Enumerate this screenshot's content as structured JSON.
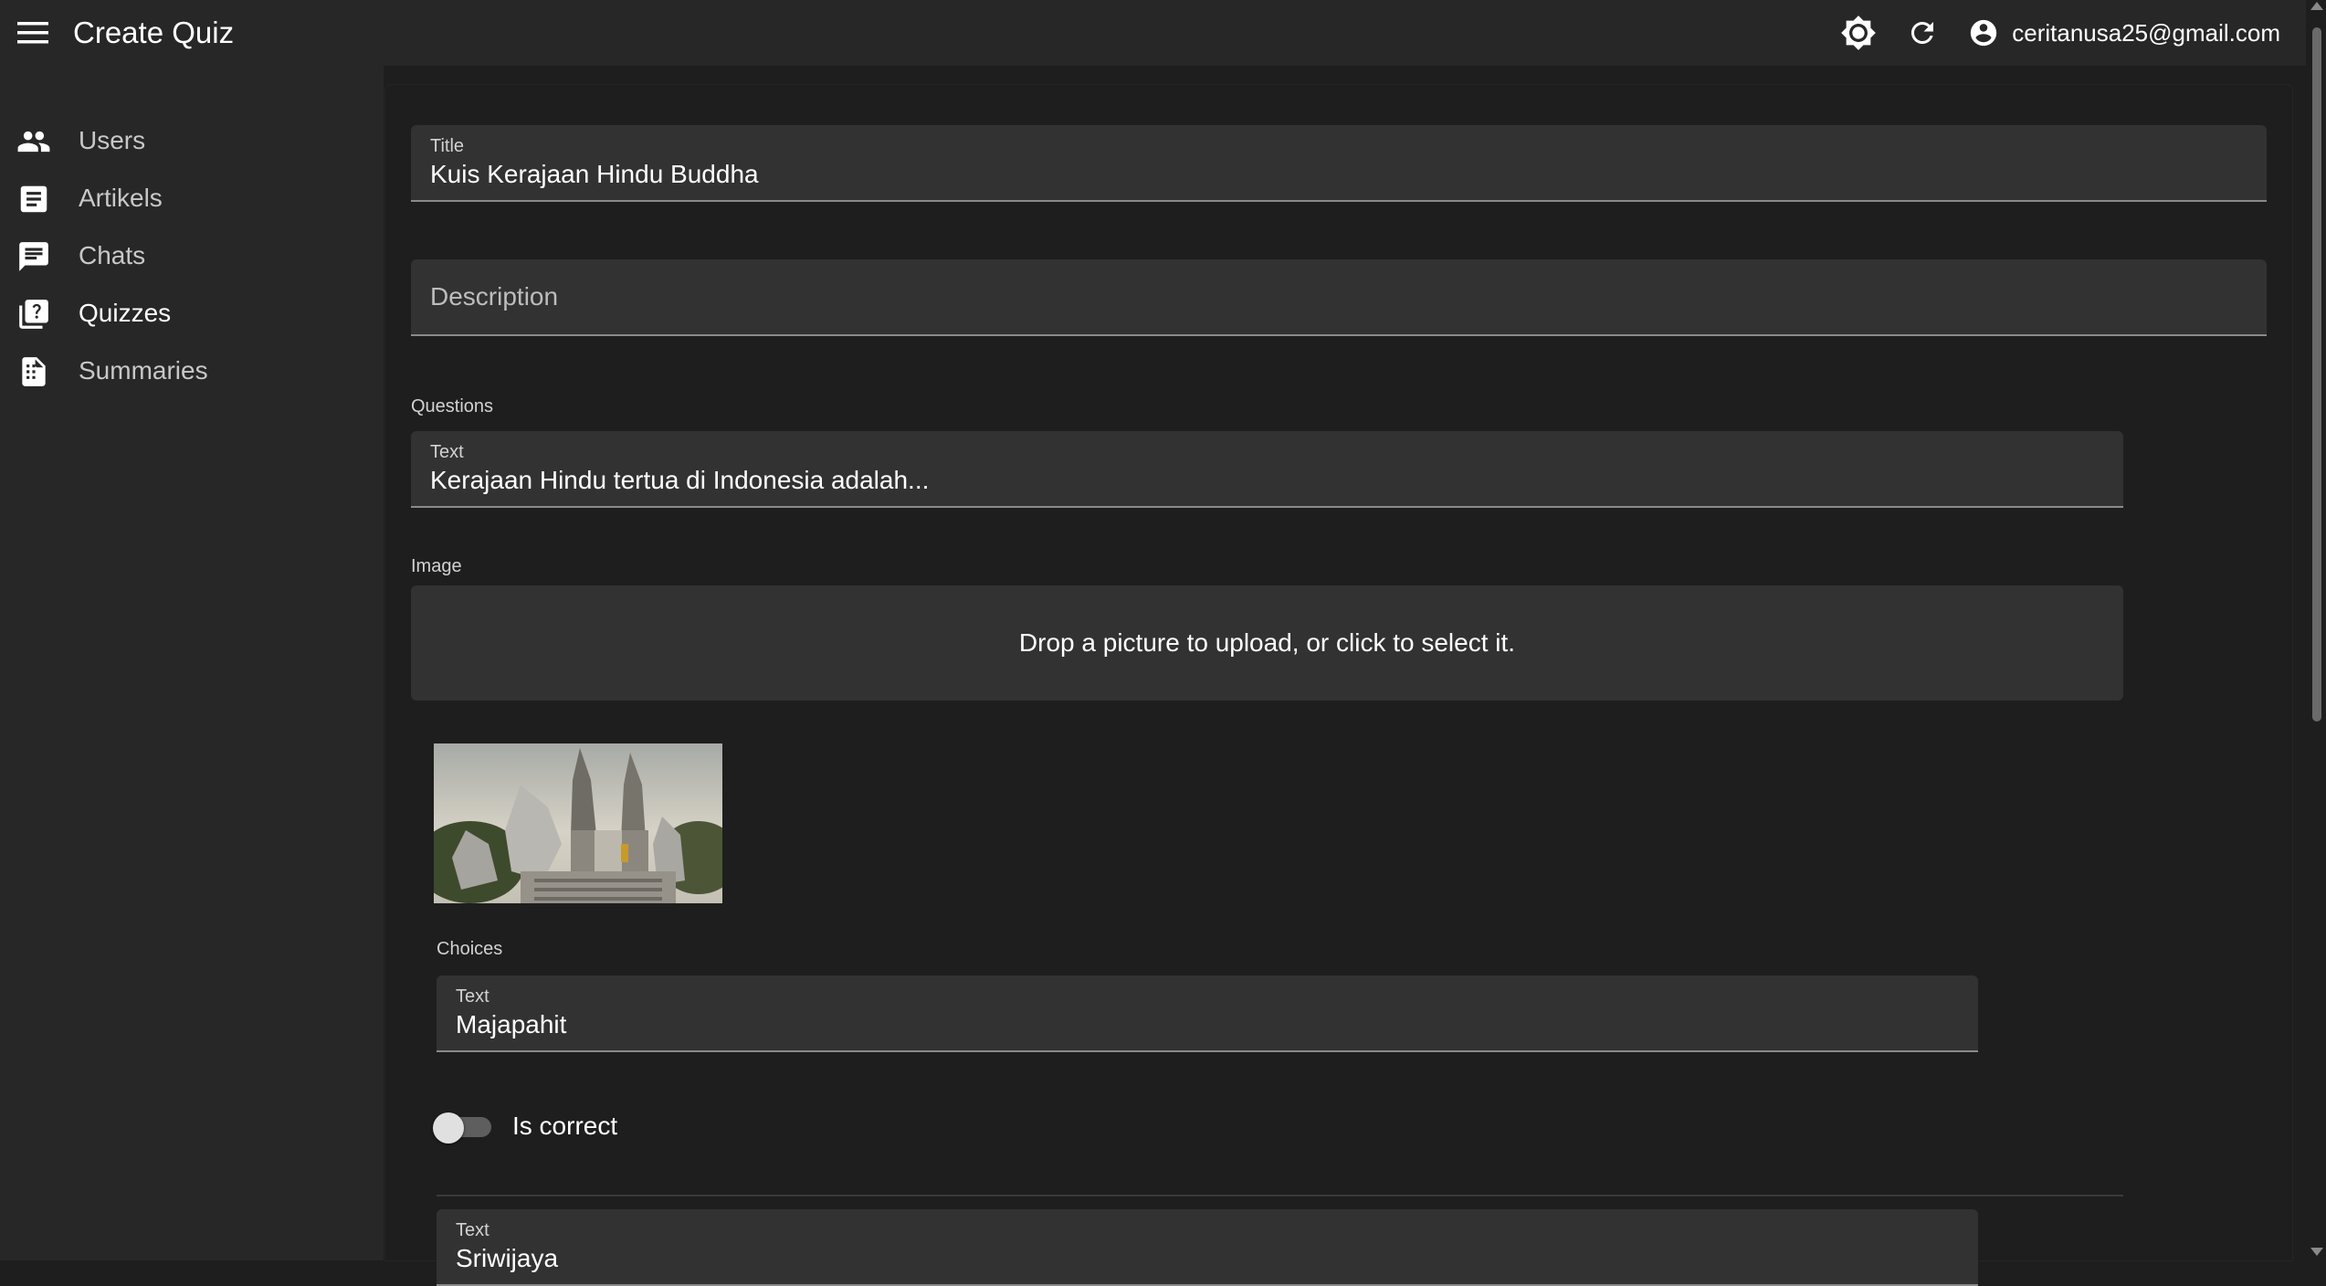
{
  "appbar": {
    "title": "Create Quiz",
    "user_email": "ceritanusa25@gmail.com"
  },
  "sidebar": {
    "items": [
      {
        "label": "Users",
        "icon": "users-icon"
      },
      {
        "label": "Artikels",
        "icon": "article-icon"
      },
      {
        "label": "Chats",
        "icon": "chat-icon"
      },
      {
        "label": "Quizzes",
        "icon": "quiz-icon"
      },
      {
        "label": "Summaries",
        "icon": "summary-icon"
      }
    ],
    "active": "Quizzes"
  },
  "form": {
    "title_label": "Title",
    "title_value": "Kuis Kerajaan Hindu Buddha",
    "description_placeholder": "Description",
    "questions_label": "Questions",
    "question": {
      "text_label": "Text",
      "text_value": "Kerajaan Hindu tertua di Indonesia adalah...",
      "image_label": "Image",
      "dropzone_text": "Drop a picture to upload, or click to select it.",
      "choices_label": "Choices",
      "choices": [
        {
          "text_label": "Text",
          "text_value": "Majapahit",
          "is_correct_label": "Is correct",
          "is_correct": false
        },
        {
          "text_label": "Text",
          "text_value": "Sriwijaya"
        }
      ]
    }
  },
  "colors": {
    "background": "#1e1e1e",
    "surface": "#272727",
    "field": "#323232"
  }
}
